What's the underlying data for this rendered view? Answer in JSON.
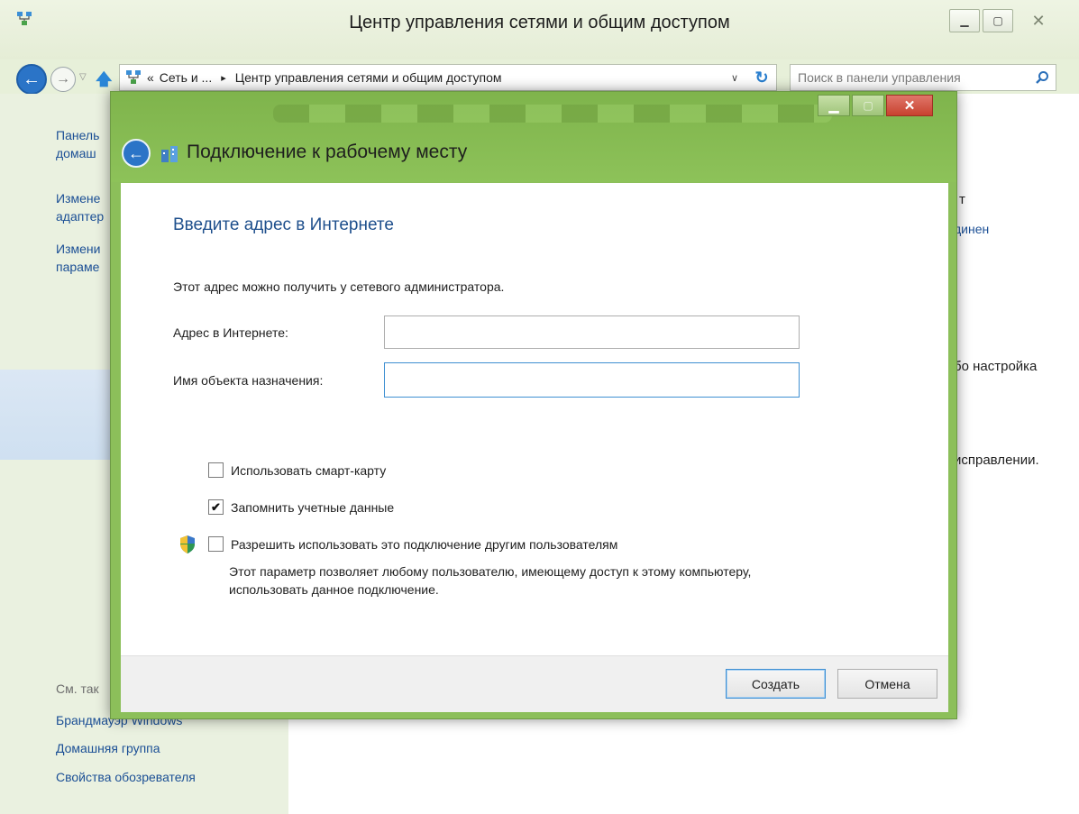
{
  "background_window": {
    "title": "Центр управления сетями и общим доступом",
    "address_prefix": "«",
    "address_crumb1": "Сеть и ...",
    "address_sep": "▸",
    "address_crumb2": "Центр управления сетями и общим доступом",
    "search_placeholder": "Поиск в панели управления",
    "sidebar_top": [
      "Панель",
      "домаш",
      "Измене",
      "адаптер",
      "Измени",
      "параме"
    ],
    "see_also": "См. так",
    "sidebar_bottom": [
      "Брандмауэр Windows",
      "Домашняя группа",
      "Свойства обозревателя"
    ],
    "content_fragments": [
      "т",
      "динен",
      "бо настройка",
      "исправлении."
    ]
  },
  "dialog": {
    "title": "Подключение к рабочему месту",
    "heading": "Введите адрес в Интернете",
    "description": "Этот адрес можно получить у сетевого администратора.",
    "address_label": "Адрес в Интернете:",
    "address_value": "",
    "dest_label": "Имя объекта назначения:",
    "dest_value": "",
    "options": [
      {
        "label": "Использовать смарт-карту",
        "checked": false
      },
      {
        "label": "Запомнить учетные данные",
        "checked": true
      },
      {
        "label": "Разрешить использовать это подключение другим пользователям",
        "checked": false
      }
    ],
    "allow_note": "Этот параметр позволяет любому пользователю, имеющему доступ к этому компьютеру, использовать данное подключение.",
    "create_button": "Создать",
    "cancel_button": "Отмена"
  },
  "colors": {
    "accent": "#2b74c7",
    "dialog_frame": "#8cbf5a",
    "link": "#1b4f95"
  }
}
